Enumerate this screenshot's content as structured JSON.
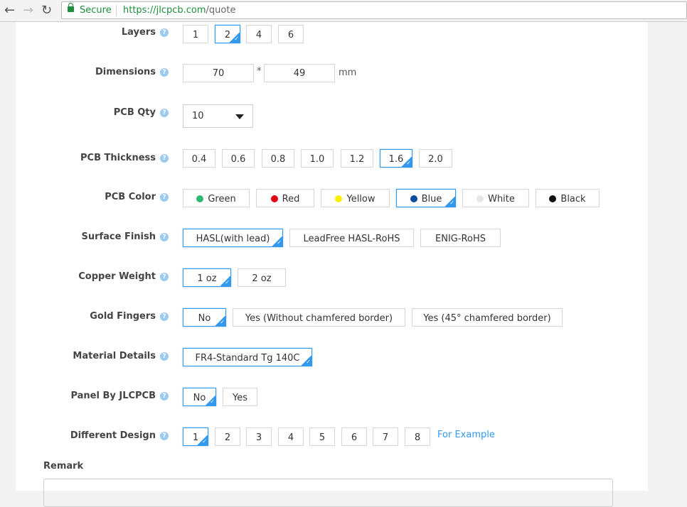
{
  "browser": {
    "back": "←",
    "forward": "→",
    "reload": "↻",
    "secure": "Secure",
    "url_host": "https://jlcpcb.com",
    "url_path": "/quote"
  },
  "rows": {
    "layers": {
      "label": "Layers",
      "options": [
        "1",
        "2",
        "4",
        "6"
      ],
      "selected": "2"
    },
    "dimensions": {
      "label": "Dimensions",
      "width": "70",
      "height": "49",
      "times": "*",
      "unit": "mm"
    },
    "qty": {
      "label": "PCB Qty",
      "value": "10"
    },
    "thickness": {
      "label": "PCB Thickness",
      "options": [
        "0.4",
        "0.6",
        "0.8",
        "1.0",
        "1.2",
        "1.6",
        "2.0"
      ],
      "selected": "1.6"
    },
    "color": {
      "label": "PCB Color",
      "options": [
        {
          "name": "Green",
          "hex": "#2eb872"
        },
        {
          "name": "Red",
          "hex": "#e60012"
        },
        {
          "name": "Yellow",
          "hex": "#ffee00"
        },
        {
          "name": "Blue",
          "hex": "#0a4a9f"
        },
        {
          "name": "White",
          "hex": "#e6e6e6"
        },
        {
          "name": "Black",
          "hex": "#111111"
        }
      ],
      "selected": "Blue"
    },
    "surface": {
      "label": "Surface Finish",
      "options": [
        "HASL(with lead)",
        "LeadFree HASL-RoHS",
        "ENIG-RoHS"
      ],
      "selected": "HASL(with lead)"
    },
    "copper": {
      "label": "Copper Weight",
      "options": [
        "1 oz",
        "2 oz"
      ],
      "selected": "1 oz"
    },
    "gold": {
      "label": "Gold Fingers",
      "options": [
        "No",
        "Yes (Without chamfered border)",
        "Yes (45° chamfered border)"
      ],
      "selected": "No"
    },
    "material": {
      "label": "Material Details",
      "options": [
        "FR4-Standard Tg 140C"
      ],
      "selected": "FR4-Standard Tg 140C"
    },
    "panel": {
      "label": "Panel By JLCPCB",
      "options": [
        "No",
        "Yes"
      ],
      "selected": "No"
    },
    "design": {
      "label": "Different Design",
      "options": [
        "1",
        "2",
        "3",
        "4",
        "5",
        "6",
        "7",
        "8"
      ],
      "selected": "1",
      "link": "For Example"
    }
  },
  "help_glyph": "?",
  "remark": {
    "label": "Remark"
  }
}
